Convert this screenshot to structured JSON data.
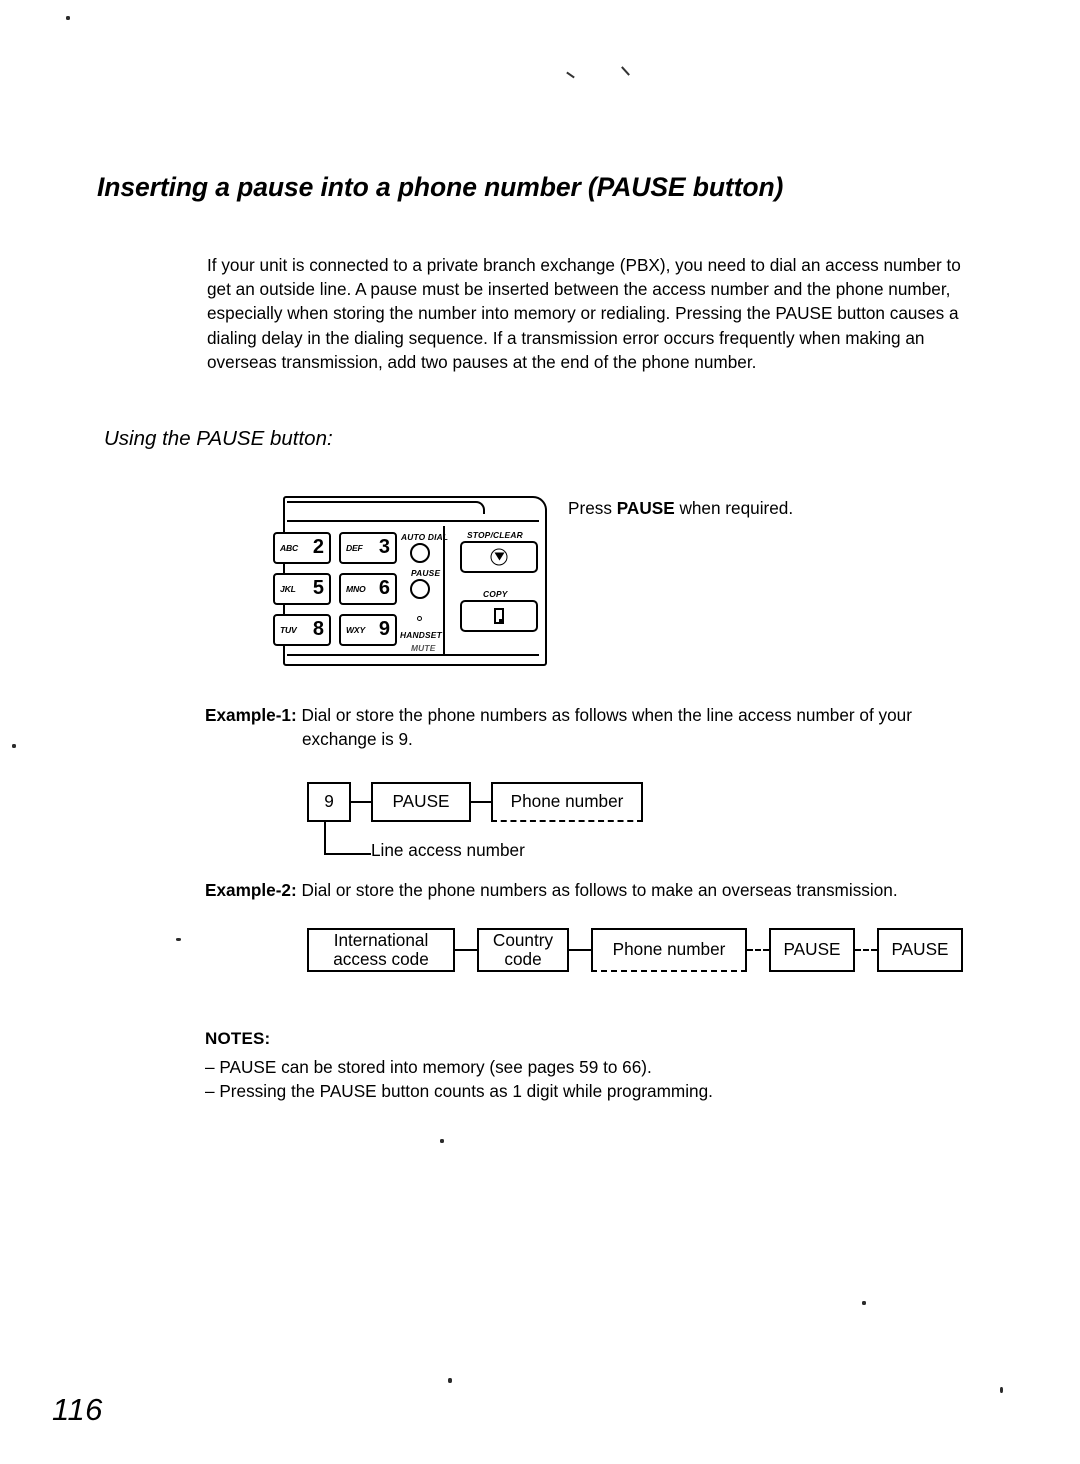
{
  "document": {
    "page_number": "116",
    "title": "Inserting a pause into a phone number (PAUSE button)",
    "intro_paragraph": "If your unit is connected to a private branch exchange (PBX), you need to dial an access number to get an outside line. A pause must be inserted between the access number and the phone number, especially when storing the number into memory or redialing. Pressing the PAUSE button causes a dialing delay in the dialing sequence. If a transmission error occurs frequently when making an overseas transmission, add two pauses at the end of the phone number.",
    "subheading": "Using the PAUSE button:"
  },
  "keypad": {
    "press_note_prefix": "Press ",
    "press_note_emphasis": "PAUSE",
    "press_note_suffix": " when required.",
    "keys": [
      {
        "letters": "ABC",
        "digit": "2"
      },
      {
        "letters": "DEF",
        "digit": "3"
      },
      {
        "letters": "JKL",
        "digit": "5"
      },
      {
        "letters": "MNO",
        "digit": "6"
      },
      {
        "letters": "TUV",
        "digit": "8"
      },
      {
        "letters": "WXY",
        "digit": "9"
      }
    ],
    "auto_dial_label": "AUTO DIAL",
    "pause_label": "PAUSE",
    "handset_label": "HANDSET",
    "handset_sub_label": "MUTE",
    "stop_clear_label": "STOP/CLEAR",
    "copy_label": "COPY"
  },
  "example1": {
    "label": "Example-1:",
    "text_line1": " Dial or store the phone numbers as follows when the line access number of your",
    "text_line2": "exchange is 9.",
    "flow": [
      {
        "text": "9"
      },
      {
        "text": "PAUSE"
      },
      {
        "text": "Phone number"
      }
    ],
    "callout": "Line access number"
  },
  "example2": {
    "label": "Example-2:",
    "text": " Dial or store the phone numbers as follows to make an overseas transmission.",
    "flow": [
      {
        "line1": "International",
        "line2": "access code"
      },
      {
        "line1": "Country",
        "line2": "code"
      },
      {
        "line1": "Phone number",
        "line2": ""
      },
      {
        "line1": "PAUSE",
        "line2": ""
      },
      {
        "line1": "PAUSE",
        "line2": ""
      }
    ]
  },
  "notes": {
    "title": "NOTES:",
    "items": [
      "– PAUSE can be stored into memory (see pages 59 to 66).",
      "– Pressing the PAUSE button counts as 1 digit while programming."
    ]
  }
}
